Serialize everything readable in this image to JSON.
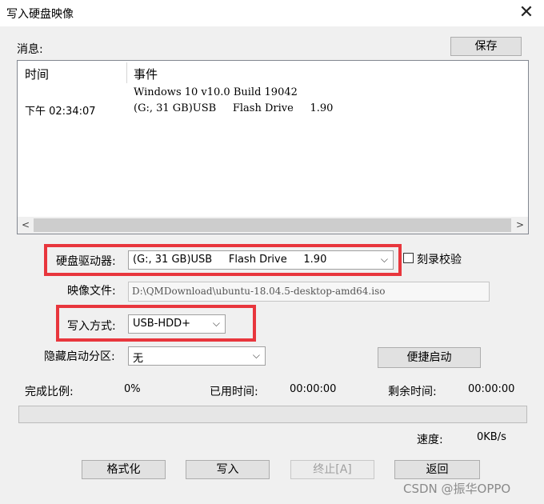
{
  "window": {
    "title": "写入硬盘映像",
    "close_glyph": "✕"
  },
  "messages": {
    "label": "消息:",
    "save_button": "保存",
    "columns": [
      "时间",
      "事件"
    ],
    "rows": [
      {
        "time": "",
        "event": "Windows 10 v10.0 Build 19042"
      },
      {
        "time": "下午 02:34:07",
        "event": "(G:, 31 GB)USB     Flash Drive     1.90"
      }
    ],
    "scroll_left": "<",
    "scroll_right": ">"
  },
  "drive": {
    "label": "硬盘驱动器:",
    "value": "(G:, 31 GB)USB     Flash Drive     1.90",
    "verify_label": "刻录校验"
  },
  "image_file": {
    "label": "映像文件:",
    "value": "D:\\QMDownload\\ubuntu-18.04.5-desktop-amd64.iso"
  },
  "write_method": {
    "label": "写入方式:",
    "value": "USB-HDD+"
  },
  "hidden_partition": {
    "label": "隐藏启动分区:",
    "value": "无"
  },
  "quick_boot_button": "便捷启动",
  "status": {
    "complete_label": "完成比例:",
    "complete_value": "0%",
    "elapsed_label": "已用时间:",
    "elapsed_value": "00:00:00",
    "remaining_label": "剩余时间:",
    "remaining_value": "00:00:00",
    "progress": 0,
    "speed_label": "速度:",
    "speed_value": "0KB/s"
  },
  "buttons": {
    "format": "格式化",
    "write": "写入",
    "abort": "终止[A]",
    "back": "返回"
  },
  "watermark": "CSDN @振华OPPO",
  "colors": {
    "highlight": "#e8363d",
    "panel_border": "#828790"
  }
}
